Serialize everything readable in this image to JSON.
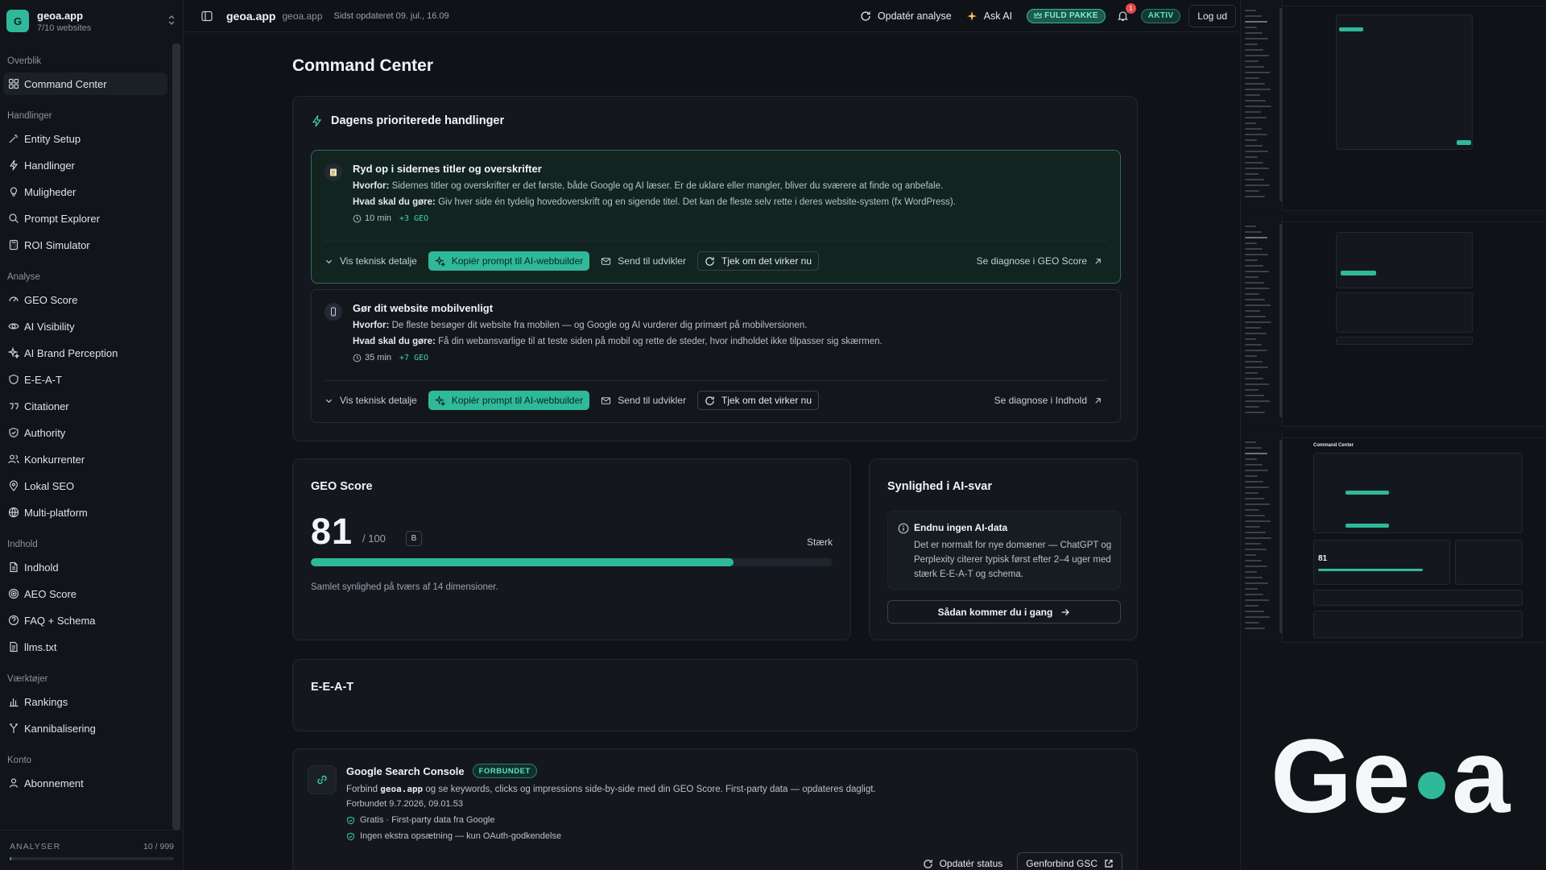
{
  "brand": {
    "name": "geoa.app",
    "sub": "7/10 websites",
    "logo_letter": "G",
    "accent": "#2fb99a"
  },
  "sidebar": {
    "sections": [
      {
        "title": "Overblik",
        "items": [
          {
            "label": "Command Center",
            "icon": "grid-icon",
            "active": true
          }
        ]
      },
      {
        "title": "Handlinger",
        "items": [
          {
            "label": "Entity Setup",
            "icon": "wand-icon"
          },
          {
            "label": "Handlinger",
            "icon": "bolt-icon"
          },
          {
            "label": "Muligheder",
            "icon": "lightbulb-icon"
          },
          {
            "label": "Prompt Explorer",
            "icon": "search-icon"
          },
          {
            "label": "ROI Simulator",
            "icon": "calculator-icon"
          }
        ]
      },
      {
        "title": "Analyse",
        "items": [
          {
            "label": "GEO Score",
            "icon": "gauge-icon"
          },
          {
            "label": "AI Visibility",
            "icon": "eye-icon"
          },
          {
            "label": "AI Brand Perception",
            "icon": "sparkle-icon"
          },
          {
            "label": "E-E-A-T",
            "icon": "shield-icon"
          },
          {
            "label": "Citationer",
            "icon": "quote-icon"
          },
          {
            "label": "Authority",
            "icon": "shield-check-icon"
          },
          {
            "label": "Konkurrenter",
            "icon": "users-icon"
          },
          {
            "label": "Lokal SEO",
            "icon": "map-pin-icon"
          },
          {
            "label": "Multi-platform",
            "icon": "globe-icon"
          }
        ]
      },
      {
        "title": "Indhold",
        "items": [
          {
            "label": "Indhold",
            "icon": "file-icon"
          },
          {
            "label": "AEO Score",
            "icon": "target-icon"
          },
          {
            "label": "FAQ + Schema",
            "icon": "help-circle-icon"
          },
          {
            "label": "llms.txt",
            "icon": "file-text-icon"
          }
        ]
      },
      {
        "title": "Værktøjer",
        "items": [
          {
            "label": "Rankings",
            "icon": "bar-chart-icon"
          },
          {
            "label": "Kannibalisering",
            "icon": "split-icon"
          }
        ]
      },
      {
        "title": "Konto",
        "items": [
          {
            "label": "Abonnement",
            "icon": "user-icon"
          }
        ]
      }
    ],
    "footer": {
      "label": "ANALYSER",
      "count": "10 / 999",
      "used": 10,
      "total": 999
    }
  },
  "topbar": {
    "site": "geoa.app",
    "domain": "geoa.app",
    "updated": "Sidst opdateret 09. jul., 16.09",
    "refresh_label": "Opdatér analyse",
    "ask_label": "Ask AI",
    "plan_badge": "FULD PAKKE",
    "notifications": "1",
    "status_badge": "AKTIV",
    "logout_label": "Log ud"
  },
  "main": {
    "title": "Command Center",
    "priorities": {
      "title": "Dagens prioriterede handlinger",
      "tasks": [
        {
          "icon": "note-icon",
          "title": "Ryd op i sidernes titler og overskrifter",
          "why_label": "Hvorfor:",
          "why": "Sidernes titler og overskrifter er det første, både Google og AI læser. Er de uklare eller mangler, bliver du sværere at finde og anbefale.",
          "do_label": "Hvad skal du gøre:",
          "do": "Giv hver side én tydelig hovedoverskrift og en sigende titel. Det kan de fleste selv rette i deres website-system (fx WordPress).",
          "time": "10 min",
          "geo": "+3 GEO",
          "detail_label": "Vis teknisk detalje",
          "copy_label": "Kopiér prompt til AI-webbuilder",
          "send_label": "Send til udvikler",
          "check_label": "Tjek om det virker nu",
          "diag_label": "Se diagnose i GEO Score"
        },
        {
          "icon": "phone-icon",
          "title": "Gør dit website mobilvenligt",
          "why_label": "Hvorfor:",
          "why": "De fleste besøger dit website fra mobilen — og Google og AI vurderer dig primært på mobilversionen.",
          "do_label": "Hvad skal du gøre:",
          "do": "Få din webansvarlige til at teste siden på mobil og rette de steder, hvor indholdet ikke tilpasser sig skærmen.",
          "time": "35 min",
          "geo": "+7 GEO",
          "detail_label": "Vis teknisk detalje",
          "copy_label": "Kopiér prompt til AI-webbuilder",
          "send_label": "Send til udvikler",
          "check_label": "Tjek om det virker nu",
          "diag_label": "Se diagnose i Indhold"
        }
      ]
    },
    "geo_score": {
      "title": "GEO Score",
      "value": "81",
      "max": "/ 100",
      "grade": "B",
      "strength": "Stærk",
      "fraction": 0.81,
      "desc": "Samlet synlighed på tværs af 14 dimensioner."
    },
    "visibility": {
      "title": "Synlighed i AI-svar",
      "box_title": "Endnu ingen AI-data",
      "box_text": "Det er normalt for nye domæner — ChatGPT og Perplexity citerer typisk først efter 2–4 uger med stærk E-E-A-T og schema.",
      "button": "Sådan kommer du i gang"
    },
    "eeat": {
      "title": "E-E-A-T"
    },
    "gsc": {
      "title": "Google Search Console",
      "badge": "FORBUNDET",
      "text_pre": "Forbind",
      "text_domain": "geoa.app",
      "text_post": "og se keywords, clicks og impressions side-by-side med din GEO Score. First-party data — opdateres dagligt.",
      "since": "Forbundet 9.7.2026, 09.01.53",
      "checks": [
        "Gratis · First-party data fra Google",
        "Ingen ekstra opsætning — kun OAuth-godkendelse"
      ],
      "refresh_label": "Opdatér status",
      "reconnect_label": "Genforbind GSC"
    }
  },
  "preview": {
    "logo_text": "Geoa",
    "thumb_title": "Command Center",
    "thumb_score": "81"
  }
}
